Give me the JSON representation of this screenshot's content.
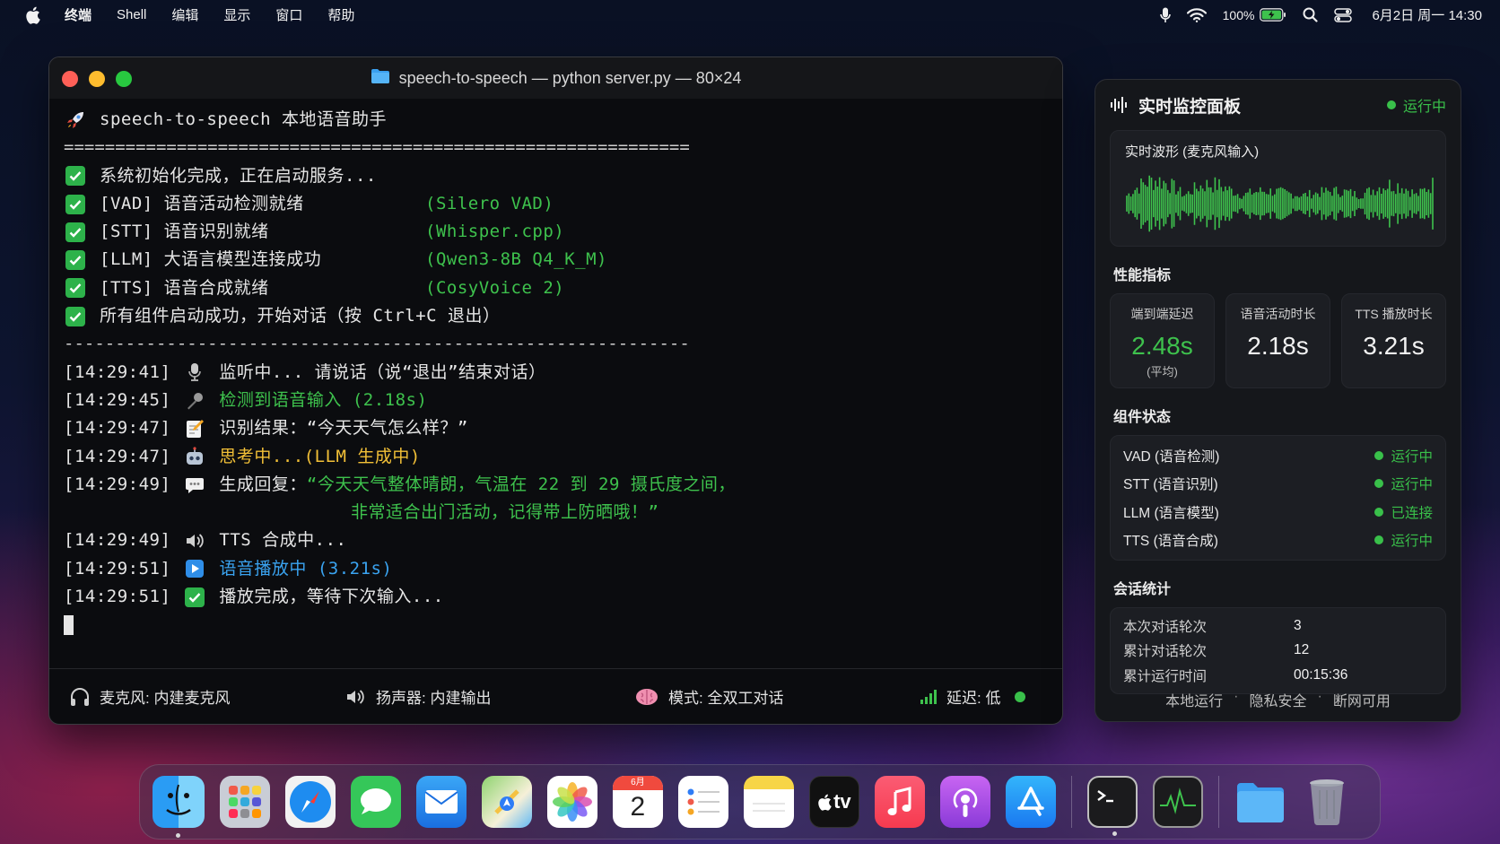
{
  "menubar": {
    "items": [
      "终端",
      "Shell",
      "编辑",
      "显示",
      "窗口",
      "帮助"
    ],
    "battery": "100%",
    "clock": "6月2日 周一 14:30"
  },
  "terminal": {
    "title": "speech-to-speech — python server.py — 80×24",
    "header": "speech-to-speech 本地语音助手",
    "double_rule": "=============================================================",
    "single_rule": "-------------------------------------------------------------",
    "init_lines": [
      {
        "text": "系统初始化完成，正在启动服务...",
        "detail": ""
      },
      {
        "text": "[VAD] 语音活动检测就绪",
        "detail": "(Silero VAD)"
      },
      {
        "text": "[STT] 语音识别就绪",
        "detail": "(Whisper.cpp)"
      },
      {
        "text": "[LLM] 大语言模型连接成功",
        "detail": "(Qwen3-8B Q4_K_M)"
      },
      {
        "text": "[TTS] 语音合成就绪",
        "detail": "(CosyVoice 2)"
      },
      {
        "text": "所有组件启动成功，开始对话（按 Ctrl+C 退出）",
        "detail": ""
      }
    ],
    "log": [
      {
        "time": "[14:29:41]",
        "text": "监听中... 请说话（说“退出”结束对话）"
      },
      {
        "time": "[14:29:45]",
        "text": "检测到语音输入 (2.18s)"
      },
      {
        "time": "[14:29:47]",
        "text": "识别结果：“今天天气怎么样？”"
      },
      {
        "time": "[14:29:47]",
        "text": "思考中...(LLM 生成中)"
      },
      {
        "time": "[14:29:49]",
        "label": "生成回复：",
        "text": "“今天天气整体晴朗，气温在 22 到 29 摄氏度之间，",
        "cont": "非常适合出门活动，记得带上防晒哦！”"
      },
      {
        "time": "[14:29:49]",
        "text": "TTS 合成中..."
      },
      {
        "time": "[14:29:51]",
        "text": "语音播放中 (3.21s)"
      },
      {
        "time": "[14:29:51]",
        "text": "播放完成，等待下次输入..."
      }
    ],
    "status": {
      "mic": "麦克风: 内建麦克风",
      "speaker": "扬声器: 内建输出",
      "mode": "模式: 全双工对话",
      "latency": "延迟: 低"
    }
  },
  "panel": {
    "title": "实时监控面板",
    "status": "运行中",
    "waveform_label": "实时波形 (麦克风输入)",
    "perf_title": "性能指标",
    "metrics": [
      {
        "label": "端到端延迟",
        "value": "2.48s",
        "sub": "(平均)"
      },
      {
        "label": "语音活动时长",
        "value": "2.18s",
        "sub": ""
      },
      {
        "label": "TTS 播放时长",
        "value": "3.21s",
        "sub": ""
      }
    ],
    "comp_title": "组件状态",
    "components": [
      {
        "name": "VAD (语音检测)",
        "status": "运行中"
      },
      {
        "name": "STT (语音识别)",
        "status": "运行中"
      },
      {
        "name": "LLM (语言模型)",
        "status": "已连接"
      },
      {
        "name": "TTS (语音合成)",
        "status": "运行中"
      }
    ],
    "stats_title": "会话统计",
    "stats": [
      {
        "label": "本次对话轮次",
        "value": "3"
      },
      {
        "label": "累计对话轮次",
        "value": "12"
      },
      {
        "label": "累计运行时间",
        "value": "00:15:36"
      }
    ],
    "footer": [
      "本地运行",
      "隐私安全",
      "断网可用"
    ]
  },
  "dock": {
    "calendar_month": "6月",
    "calendar_day": "2",
    "tv_label": "tv",
    "apps": [
      "finder-icon",
      "launchpad-icon",
      "safari-icon",
      "messages-icon",
      "mail-icon",
      "maps-icon",
      "photos-icon",
      "calendar-icon",
      "reminders-icon",
      "notes-icon",
      "tv-icon",
      "music-icon",
      "podcasts-icon",
      "app-store-icon",
      "terminal-icon",
      "activity-monitor-icon",
      "downloads-folder-icon",
      "trash-icon"
    ]
  },
  "colors": {
    "accent_green": "#3ec24d",
    "warn_yellow": "#f2c037",
    "info_blue": "#3aa3f0"
  }
}
